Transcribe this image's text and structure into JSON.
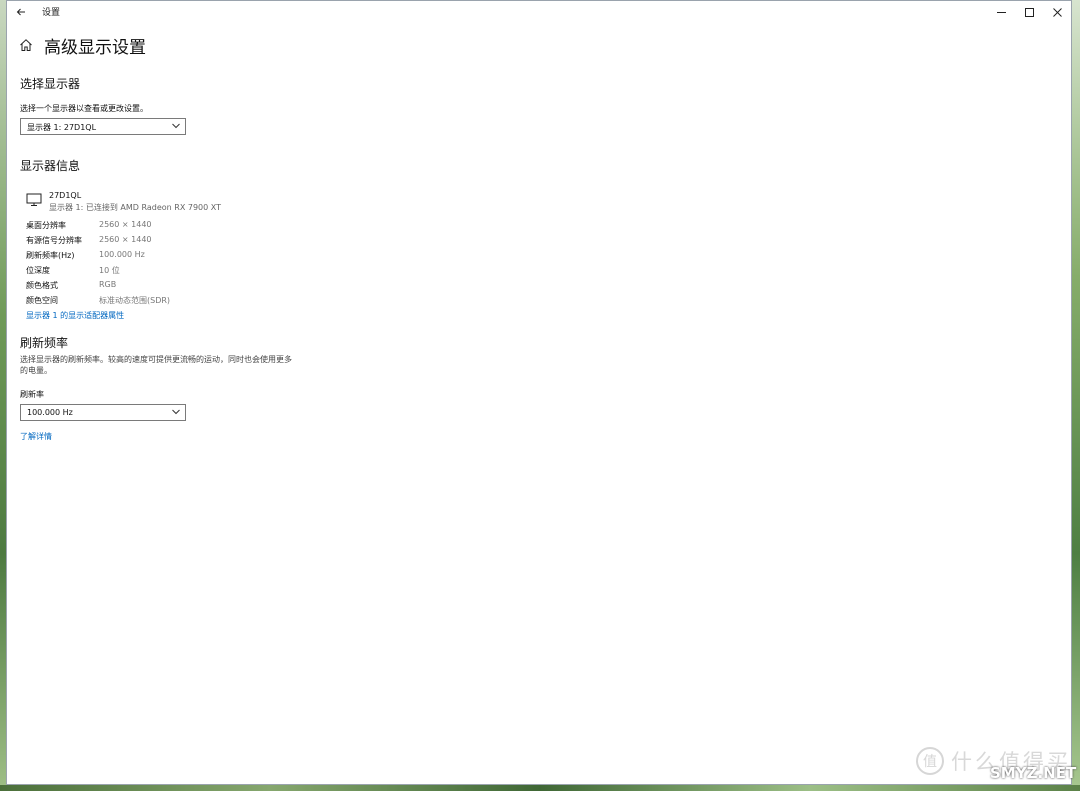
{
  "window": {
    "title": "设置"
  },
  "page": {
    "title": "高级显示设置"
  },
  "select_display": {
    "heading": "选择显示器",
    "instruction": "选择一个显示器以查看或更改设置。",
    "dropdown_value": "显示器 1: 27D1QL"
  },
  "display_info": {
    "heading": "显示器信息",
    "monitor_name": "27D1QL",
    "monitor_sub": "显示器 1: 已连接到 AMD Radeon RX 7900 XT",
    "rows": [
      {
        "label": "桌面分辨率",
        "value": "2560 × 1440"
      },
      {
        "label": "有源信号分辨率",
        "value": "2560 × 1440"
      },
      {
        "label": "刷新频率(Hz)",
        "value": "100.000 Hz"
      },
      {
        "label": "位深度",
        "value": "10 位"
      },
      {
        "label": "颜色格式",
        "value": "RGB"
      },
      {
        "label": "颜色空间",
        "value": "标准动态范围(SDR)"
      }
    ],
    "adapter_link": "显示器 1 的显示适配器属性"
  },
  "refresh_rate": {
    "heading": "刷新频率",
    "description": "选择显示器的刷新频率。较高的速度可提供更流畅的运动，同时也会使用更多的电量。",
    "field_label": "刷新率",
    "dropdown_value": "100.000 Hz",
    "learn_more_link": "了解详情"
  },
  "watermark": {
    "cn": "什么值得买",
    "en": "SMYZ.NET"
  },
  "colors": {
    "link": "#0067c0",
    "window_bg": "#ffffff"
  }
}
